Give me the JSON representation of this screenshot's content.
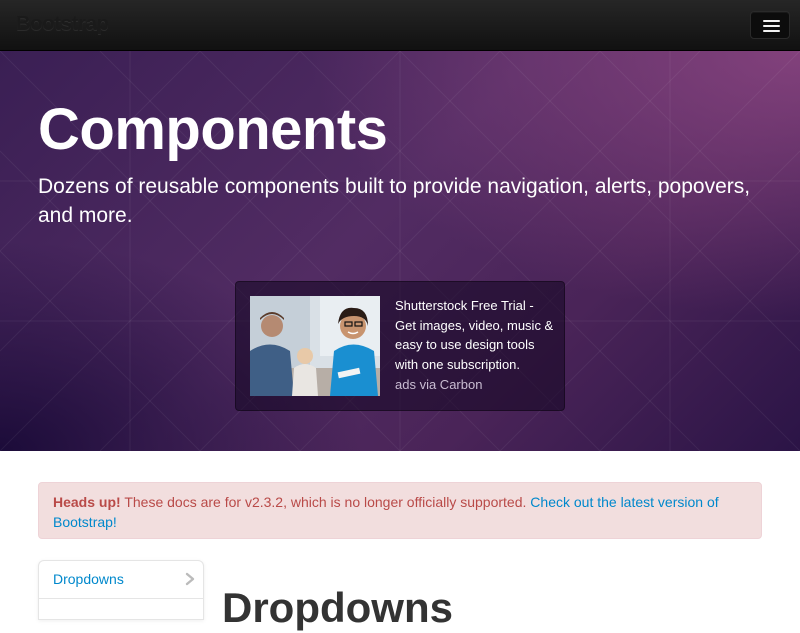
{
  "navbar": {
    "brand": "Bootstrap",
    "toggle_icon": "hamburger-menu-icon"
  },
  "hero": {
    "title": "Components",
    "subtitle": "Dozens of reusable components built to provide navigation, alerts, popovers, and more."
  },
  "carbon_ad": {
    "text": "Shutterstock Free Trial - Get images, video, music & easy to use design tools with one subscription.",
    "powered_by": "ads via Carbon"
  },
  "alert": {
    "strong": "Heads up!",
    "message": " These docs are for v2.3.2, which is no longer officially supported. ",
    "link": "Check out the latest version of Bootstrap!"
  },
  "sidebar": {
    "items": [
      {
        "label": "Dropdowns",
        "icon": "chevron-right-icon"
      }
    ]
  },
  "main": {
    "section_heading": "Dropdowns"
  },
  "colors": {
    "navbar_bg": "#1b1b1b",
    "hero_purple": "#4a2458",
    "alert_bg": "#f2dede",
    "alert_text": "#b94a48",
    "link": "#0088cc"
  }
}
